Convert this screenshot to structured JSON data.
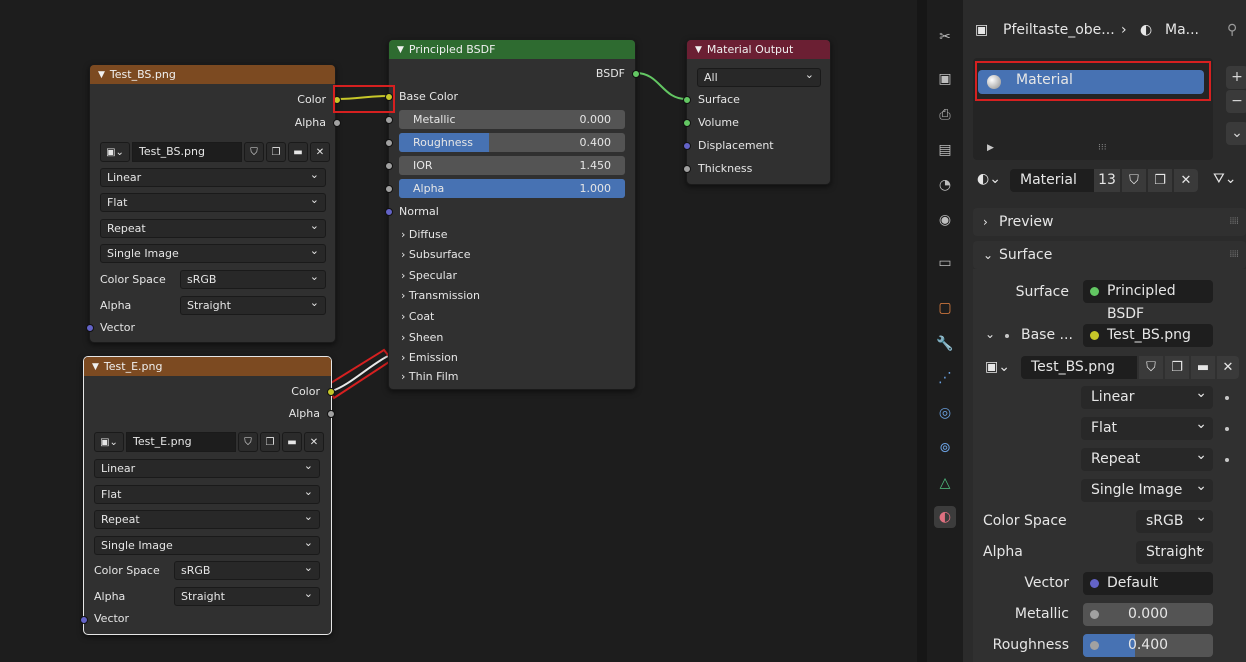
{
  "node_editor": {
    "image_node_1": {
      "title": "Test_BS.png",
      "out_color": "Color",
      "out_alpha": "Alpha",
      "image_name": "Test_BS.png",
      "interpolation": "Linear",
      "projection": "Flat",
      "extension": "Repeat",
      "source": "Single Image",
      "color_space_label": "Color Space",
      "color_space_value": "sRGB",
      "alpha_label": "Alpha",
      "alpha_value": "Straight",
      "in_vector": "Vector"
    },
    "image_node_2": {
      "title": "Test_E.png",
      "out_color": "Color",
      "out_alpha": "Alpha",
      "image_name": "Test_E.png",
      "interpolation": "Linear",
      "projection": "Flat",
      "extension": "Repeat",
      "source": "Single Image",
      "color_space_label": "Color Space",
      "color_space_value": "sRGB",
      "alpha_label": "Alpha",
      "alpha_value": "Straight",
      "in_vector": "Vector"
    },
    "bsdf_node": {
      "title": "Principled BSDF",
      "out_bsdf": "BSDF",
      "base_color": "Base Color",
      "metallic": {
        "label": "Metallic",
        "value": "0.000",
        "fraction": 0
      },
      "roughness": {
        "label": "Roughness",
        "value": "0.400",
        "fraction": 0.4
      },
      "ior": {
        "label": "IOR",
        "value": "1.450",
        "fraction": 0
      },
      "alpha": {
        "label": "Alpha",
        "value": "1.000",
        "fraction": 1
      },
      "normal": "Normal",
      "panels": [
        "Diffuse",
        "Subsurface",
        "Specular",
        "Transmission",
        "Coat",
        "Sheen",
        "Emission",
        "Thin Film"
      ]
    },
    "output_node": {
      "title": "Material Output",
      "target": "All",
      "surface": "Surface",
      "volume": "Volume",
      "displacement": "Displacement",
      "thickness": "Thickness"
    }
  },
  "properties": {
    "breadcrumb_object": "Pfeiltaste_obe...",
    "breadcrumb_material": "Ma...",
    "slot_name": "Material",
    "material_name": "Material",
    "user_count": "13",
    "preview_label": "Preview",
    "surface_section": "Surface",
    "surface_label": "Surface",
    "surface_value": "Principled BSDF",
    "base_label": "Base ...",
    "base_value": "Test_BS.png",
    "image_name": "Test_BS.png",
    "interpolation": "Linear",
    "projection": "Flat",
    "extension": "Repeat",
    "source": "Single Image",
    "color_space_label": "Color Space",
    "color_space_value": "sRGB",
    "alpha_label": "Alpha",
    "alpha_value": "Straight",
    "vector_label": "Vector",
    "vector_value": "Default",
    "metallic_label": "Metallic",
    "metallic_value": "0.000",
    "roughness_label": "Roughness",
    "roughness_value": "0.400",
    "roughness_fraction": 0.4
  },
  "colors": {
    "socket_color": "#c7c729",
    "socket_vector": "#6363c7",
    "socket_shader": "#63c763",
    "highlight": "#d62020",
    "accent": "#4772b3"
  }
}
